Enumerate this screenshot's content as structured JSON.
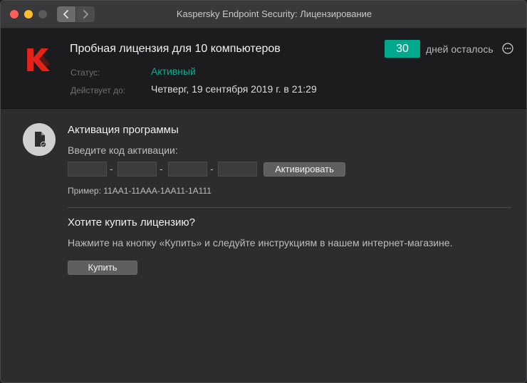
{
  "window": {
    "title": "Kaspersky Endpoint Security: Лицензирование"
  },
  "license": {
    "title": "Пробная лицензия для 10 компьютеров",
    "days_count": "30",
    "days_left_label": "дней осталось",
    "status_label": "Статус:",
    "status_value": "Активный",
    "valid_label": "Действует до:",
    "valid_value": "Четверг, 19 сентября 2019 г. в 21:29"
  },
  "activation": {
    "title": "Активация программы",
    "prompt": "Введите код активации:",
    "code_fields": [
      "",
      "",
      "",
      ""
    ],
    "separator": "-",
    "activate_label": "Активировать",
    "example": "Пример: 11AA1-11AAA-1AA11-1A111"
  },
  "purchase": {
    "title": "Хотите купить лицензию?",
    "description": "Нажмите на кнопку «Купить» и следуйте инструкциям в нашем интернет-магазине.",
    "buy_label": "Купить"
  },
  "colors": {
    "accent": "#00a88e",
    "status": "#00b394",
    "logo_red": "#e2231a"
  },
  "icons": {
    "close": "close-icon",
    "minimize": "minimize-icon",
    "maximize": "maximize-icon",
    "back": "chevron-left-icon",
    "forward": "chevron-right-icon",
    "logo": "kaspersky-logo-icon",
    "more": "more-options-icon",
    "activation": "license-file-icon"
  }
}
